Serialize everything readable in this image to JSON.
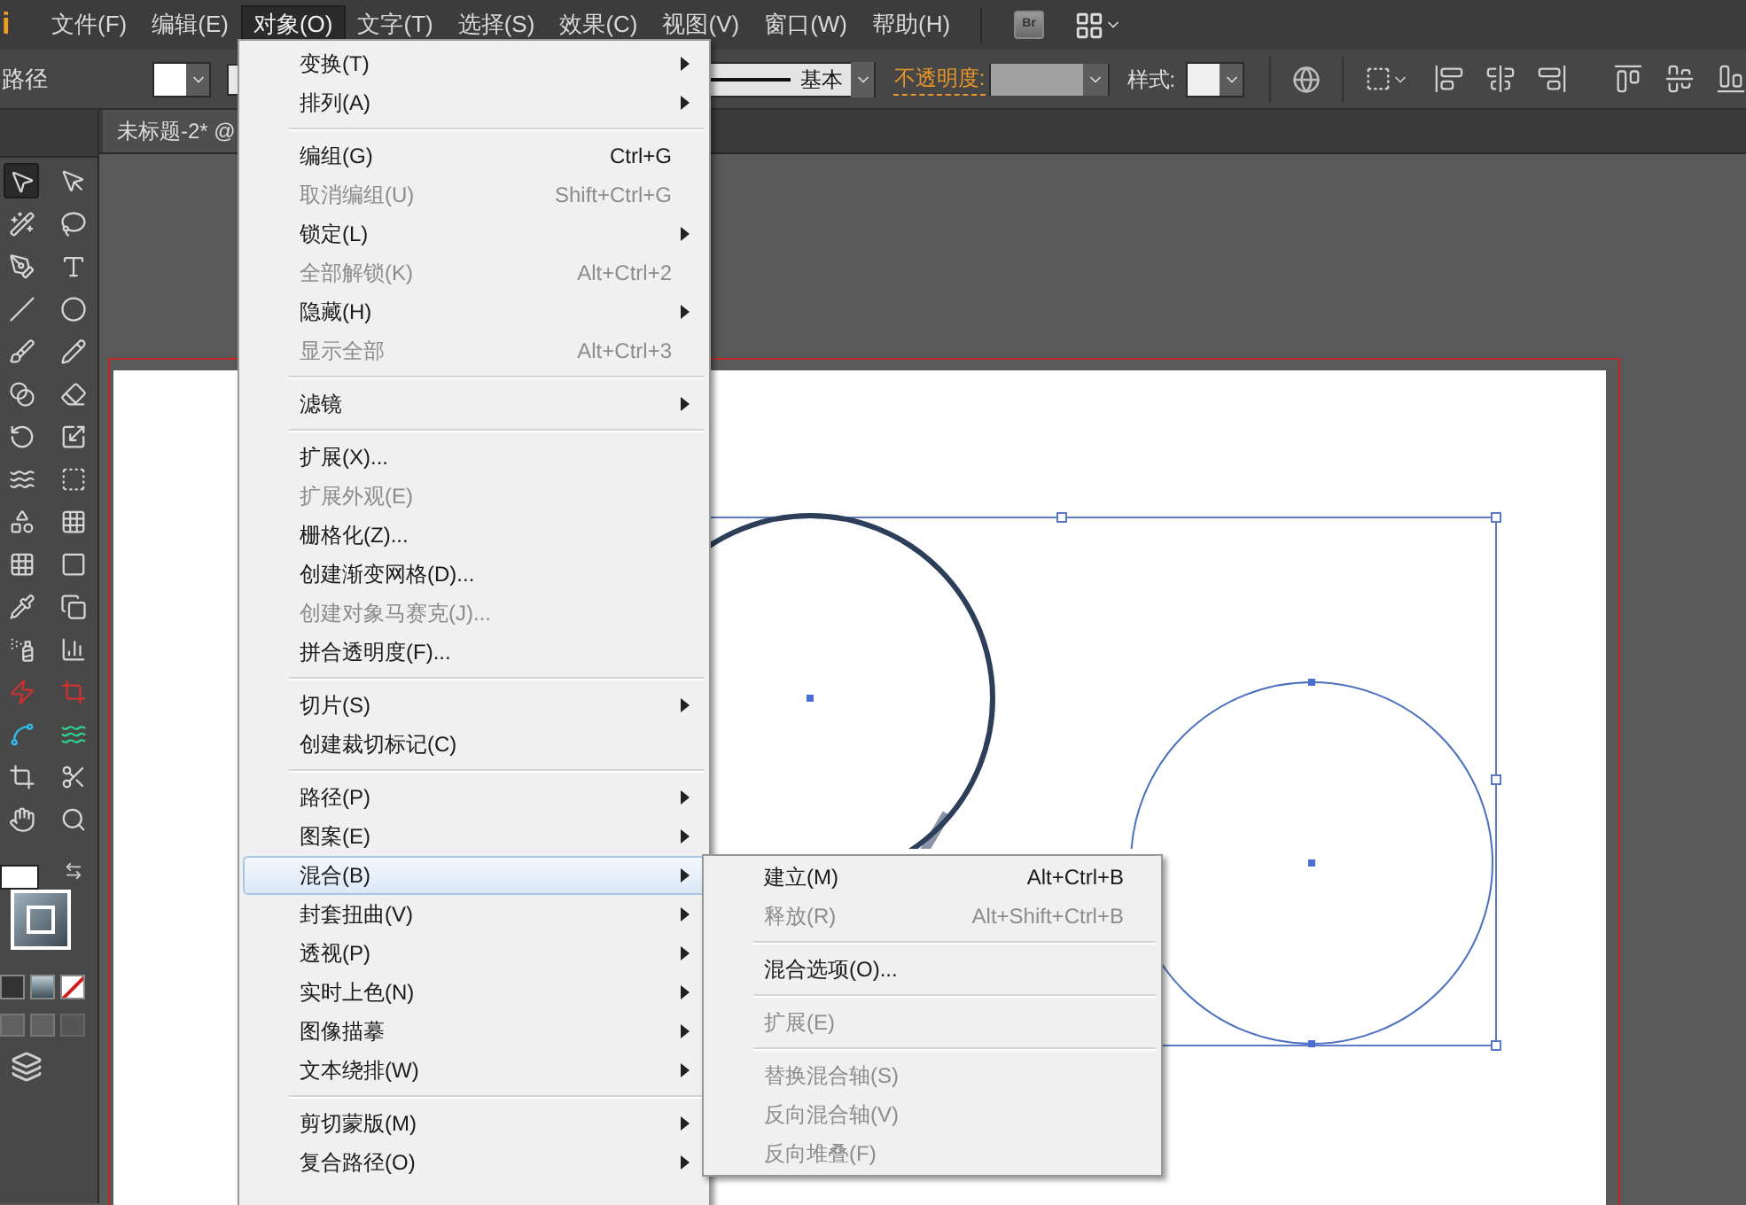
{
  "logo": "i",
  "bridge_button": "Br",
  "menu_bar": [
    {
      "label": "文件(F)",
      "selected": false
    },
    {
      "label": "编辑(E)",
      "selected": false
    },
    {
      "label": "对象(O)",
      "selected": true
    },
    {
      "label": "文字(T)",
      "selected": false
    },
    {
      "label": "选择(S)",
      "selected": false
    },
    {
      "label": "效果(C)",
      "selected": false
    },
    {
      "label": "视图(V)",
      "selected": false
    },
    {
      "label": "窗口(W)",
      "selected": false
    },
    {
      "label": "帮助(H)",
      "selected": false
    }
  ],
  "control_bar": {
    "selection_label": "路径",
    "stroke_profile": "基本",
    "opacity_label": "不透明度:",
    "style_label": "样式:"
  },
  "document_tab": {
    "title": "未标题-2* @"
  },
  "tools": [
    {
      "selected": true
    },
    {
      "selected": false
    },
    {
      "selected": false
    },
    {
      "selected": false
    },
    {
      "selected": false
    },
    {
      "selected": false
    },
    {
      "selected": false
    },
    {
      "selected": false
    },
    {
      "selected": false
    },
    {
      "selected": false
    },
    {
      "selected": false
    },
    {
      "selected": false
    },
    {
      "selected": false
    },
    {
      "selected": false
    },
    {
      "selected": false
    },
    {
      "selected": false
    },
    {
      "selected": false
    },
    {
      "selected": false
    },
    {
      "selected": false
    },
    {
      "selected": false
    },
    {
      "selected": false
    },
    {
      "selected": false
    },
    {
      "selected": false
    },
    {
      "selected": false
    },
    {
      "selected": false
    },
    {
      "selected": false
    },
    {
      "selected": false
    },
    {
      "selected": false
    },
    {
      "selected": false
    },
    {
      "selected": false
    },
    {
      "selected": false
    },
    {
      "selected": false
    }
  ],
  "object_menu": {
    "groups": [
      [
        {
          "label": "变换(T)",
          "submenu": true,
          "disabled": false,
          "selected": false
        },
        {
          "label": "排列(A)",
          "submenu": true,
          "disabled": false,
          "selected": false
        }
      ],
      [
        {
          "label": "编组(G)",
          "shortcut": "Ctrl+G",
          "submenu": false,
          "disabled": false,
          "selected": false
        },
        {
          "label": "取消编组(U)",
          "shortcut": "Shift+Ctrl+G",
          "submenu": false,
          "disabled": true,
          "selected": false
        },
        {
          "label": "锁定(L)",
          "submenu": true,
          "disabled": false,
          "selected": false
        },
        {
          "label": "全部解锁(K)",
          "shortcut": "Alt+Ctrl+2",
          "submenu": false,
          "disabled": true,
          "selected": false
        },
        {
          "label": "隐藏(H)",
          "submenu": true,
          "disabled": false,
          "selected": false
        },
        {
          "label": "显示全部",
          "shortcut": "Alt+Ctrl+3",
          "submenu": false,
          "disabled": true,
          "selected": false
        }
      ],
      [
        {
          "label": "滤镜",
          "submenu": true,
          "disabled": false,
          "selected": false
        }
      ],
      [
        {
          "label": "扩展(X)...",
          "submenu": false,
          "disabled": false,
          "selected": false
        },
        {
          "label": "扩展外观(E)",
          "submenu": false,
          "disabled": true,
          "selected": false
        },
        {
          "label": "栅格化(Z)...",
          "submenu": false,
          "disabled": false,
          "selected": false
        },
        {
          "label": "创建渐变网格(D)...",
          "submenu": false,
          "disabled": false,
          "selected": false
        },
        {
          "label": "创建对象马赛克(J)...",
          "submenu": false,
          "disabled": true,
          "selected": false
        },
        {
          "label": "拼合透明度(F)...",
          "submenu": false,
          "disabled": false,
          "selected": false
        }
      ],
      [
        {
          "label": "切片(S)",
          "submenu": true,
          "disabled": false,
          "selected": false
        },
        {
          "label": "创建裁切标记(C)",
          "submenu": false,
          "disabled": false,
          "selected": false
        }
      ],
      [
        {
          "label": "路径(P)",
          "submenu": true,
          "disabled": false,
          "selected": false
        },
        {
          "label": "图案(E)",
          "submenu": true,
          "disabled": false,
          "selected": false
        },
        {
          "label": "混合(B)",
          "submenu": true,
          "disabled": false,
          "selected": true
        },
        {
          "label": "封套扭曲(V)",
          "submenu": true,
          "disabled": false,
          "selected": false
        },
        {
          "label": "透视(P)",
          "submenu": true,
          "disabled": false,
          "selected": false
        },
        {
          "label": "实时上色(N)",
          "submenu": true,
          "disabled": false,
          "selected": false
        },
        {
          "label": "图像描摹",
          "submenu": true,
          "disabled": false,
          "selected": false
        },
        {
          "label": "文本绕排(W)",
          "submenu": true,
          "disabled": false,
          "selected": false
        }
      ],
      [
        {
          "label": "剪切蒙版(M)",
          "submenu": true,
          "disabled": false,
          "selected": false
        },
        {
          "label": "复合路径(O)",
          "submenu": true,
          "disabled": false,
          "selected": false
        }
      ]
    ]
  },
  "blend_submenu": {
    "groups": [
      [
        {
          "label": "建立(M)",
          "shortcut": "Alt+Ctrl+B",
          "disabled": false
        },
        {
          "label": "释放(R)",
          "shortcut": "Alt+Shift+Ctrl+B",
          "disabled": true
        }
      ],
      [
        {
          "label": "混合选项(O)...",
          "disabled": false
        }
      ],
      [
        {
          "label": "扩展(E)",
          "disabled": true
        }
      ],
      [
        {
          "label": "替换混合轴(S)",
          "disabled": true
        },
        {
          "label": "反向混合轴(V)",
          "disabled": true
        },
        {
          "label": "反向堆叠(F)",
          "disabled": true
        }
      ]
    ]
  }
}
